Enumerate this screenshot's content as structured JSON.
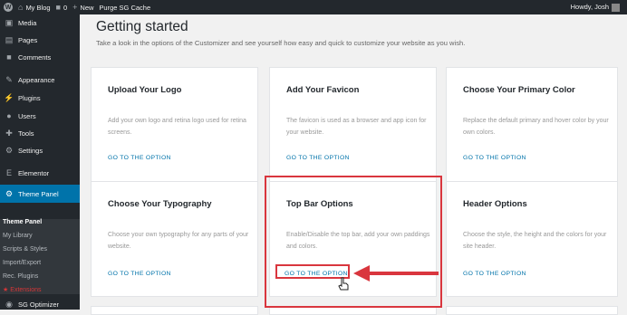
{
  "adminbar": {
    "wp_logo": "W",
    "site_name": "My Blog",
    "comments_count": "0",
    "new_label": "New",
    "purge_label": "Purge SG Cache",
    "howdy": "Howdy, Josh"
  },
  "sidebar": {
    "items": [
      {
        "label": "Media",
        "icon": "media-icon"
      },
      {
        "label": "Pages",
        "icon": "pages-icon"
      },
      {
        "label": "Comments",
        "icon": "comments-icon"
      },
      {
        "label": "Appearance",
        "icon": "appearance-icon"
      },
      {
        "label": "Plugins",
        "icon": "plugins-icon"
      },
      {
        "label": "Users",
        "icon": "users-icon"
      },
      {
        "label": "Tools",
        "icon": "tools-icon"
      },
      {
        "label": "Settings",
        "icon": "settings-icon"
      },
      {
        "label": "Elementor",
        "icon": "elementor-icon"
      },
      {
        "label": "Theme Panel",
        "icon": "theme-panel-icon"
      }
    ],
    "submenu": [
      "Theme Panel",
      "My Library",
      "Scripts & Styles",
      "Import/Export",
      "Rec. Plugins",
      "Extensions"
    ],
    "footer_item": "SG Optimizer"
  },
  "main": {
    "title": "Getting started",
    "description": "Take a look in the options of the Customizer and see yourself how easy and quick to customize your website as you wish.",
    "link_label": "GO TO THE OPTION",
    "cards": [
      {
        "title": "Upload Your Logo",
        "desc": "Add your own logo and retina logo used for retina screens."
      },
      {
        "title": "Add Your Favicon",
        "desc": "The favicon is used as a browser and app icon for your website."
      },
      {
        "title": "Choose Your Primary Color",
        "desc": "Replace the default primary and hover color by your own colors."
      },
      {
        "title": "Choose Your Typography",
        "desc": "Choose your own typography for any parts of your website."
      },
      {
        "title": "Top Bar Options",
        "desc": "Enable/Disable the top bar, add your own paddings and colors."
      },
      {
        "title": "Header Options",
        "desc": "Choose the style, the height and the colors for your site header."
      }
    ]
  },
  "colors": {
    "admin_dark": "#23282d",
    "accent_blue": "#0073aa",
    "highlight_red": "#d9363e"
  }
}
